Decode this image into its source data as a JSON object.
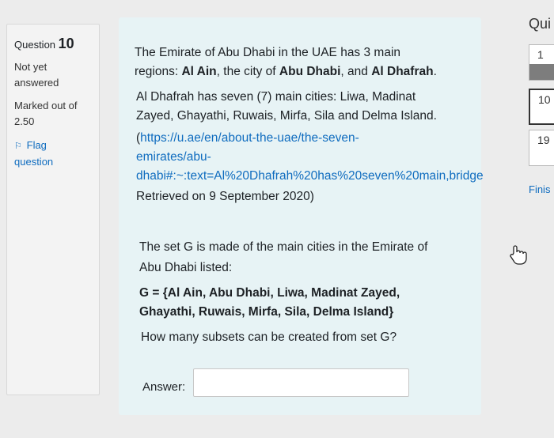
{
  "info": {
    "question_prefix": "Question",
    "question_number": "10",
    "status_line1": "Not yet",
    "status_line2": "answered",
    "marked_line1": "Marked out of",
    "marked_line2": "2.50",
    "flag_line1": "Flag",
    "flag_line2": "question"
  },
  "question": {
    "p1_line1": "The Emirate of Abu Dhabi in the UAE has 3 main",
    "p1_line2_a": "regions: ",
    "p1_line2_b": "Al Ain",
    "p1_line2_c": ", the city of ",
    "p1_line2_d": "Abu Dhabi",
    "p1_line2_e": ", and ",
    "p1_line2_f": "Al Dhafrah",
    "p1_line2_g": ".",
    "p2_line1": "Al Dhafrah has seven (7) main cities: Liwa, Madinat",
    "p2_line2": "Zayed, Ghayathi, Ruwais, Mirfa, Sila and Delma Island.",
    "p2_line3_open": "(",
    "link_line1": "https://u.ae/en/about-the-uae/the-seven-",
    "link_line2": "emirates/abu-",
    "link_line3": "dhabi#:~:text=Al%20Dhafrah%20has%20seven%20main,bridge",
    "retrieved": "Retrieved on 9 September 2020)",
    "p3_line1": "The set G is made of the main cities in the Emirate of",
    "p3_line2": "Abu Dhabi listed:",
    "set_line1": "G = {Al Ain, Abu Dhabi, Liwa, Madinat Zayed,",
    "set_line2": "Ghayathi, Ruwais, Mirfa, Sila, Delma Island}",
    "ask": "How many subsets can be created from set G?",
    "answer_label": "Answer:",
    "answer_value": ""
  },
  "nav": {
    "title": "Qui",
    "boxes": [
      "1",
      "10",
      "19"
    ],
    "finish": "Finis"
  }
}
